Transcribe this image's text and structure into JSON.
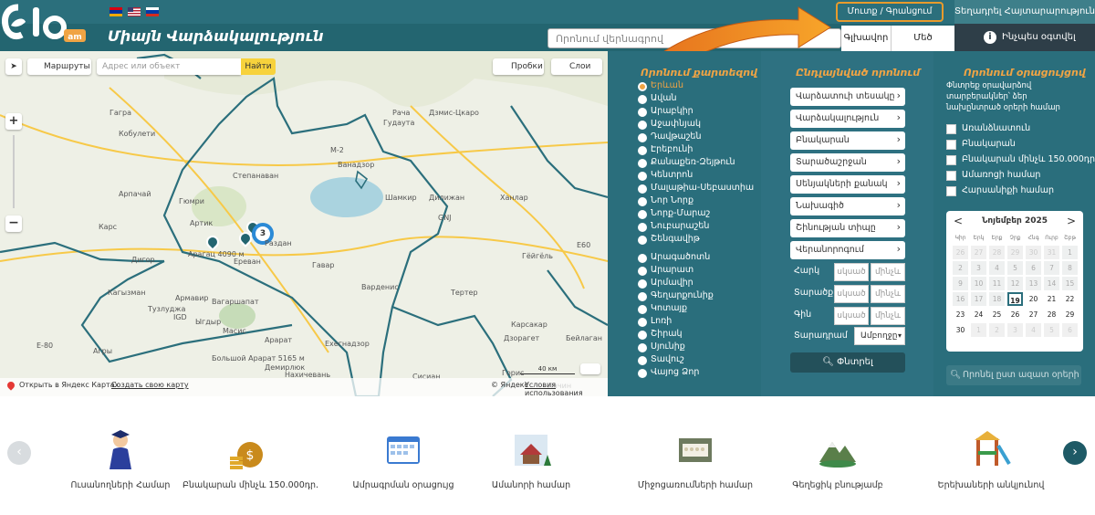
{
  "header": {
    "tagline": "Միայն Վարձակալություն",
    "search_placeholder": "Որոնում վերնագրով",
    "login_label": "Մուտք / Գրանցում",
    "add_listing_label": "Տեղադրել Հայտարարություն",
    "nav_home": "Գլխավոր",
    "nav_map": "Մեծ Քարտեզ",
    "nav_how": "Ինչպես օգտվել"
  },
  "map": {
    "routes_label": "Маршруты",
    "search_placeholder": "Адрес или объект",
    "find_label": "Найти",
    "traffic_label": "Пробки",
    "layers_label": "Слои",
    "scale_label": "40 км",
    "open_yandex_label": "Открыть в Яндекс Картах",
    "create_map_label": "Создать свою карту",
    "copyright_label": "© Яндекс",
    "terms_label": "Условия использования",
    "cluster_count": "3",
    "places": [
      "Рача",
      "Гудаута",
      "Дзмис-Цкаро",
      "М-2",
      "Ванадзор",
      "Гагра",
      "Кобулети",
      "Степанаван",
      "Дилижан",
      "Арпачай",
      "Гюмри",
      "Шамкир",
      "Артик",
      "Ханлар",
      "GNJ",
      "Карс",
      "Арагац 4090 м",
      "Раздан",
      "E60",
      "Дигор",
      "Ереван",
      "Гавар",
      "Гёйгёль",
      "Кагызман",
      "Армавир",
      "Вагаршапат",
      "Варденис",
      "Тузлуджа",
      "IGD",
      "Ыгдыр",
      "E-80",
      "Арарат",
      "Ехегнадзор",
      "Агры",
      "Масис",
      "Дзорагет",
      "Большой Арарат 5165 м",
      "Демирлюк",
      "Нахичевань",
      "Сисиан",
      "Горис",
      "Лачин",
      "Патнос",
      "Шахбуз",
      "Джульфа",
      "Мегри",
      "Бейлаган",
      "Карсакар",
      "Тертер"
    ]
  },
  "districts": {
    "title": "Որոնում քարտեզով",
    "group1": [
      "Երևան",
      "Ավան",
      "Արաբկիր",
      "Աջափնյակ",
      "Դավթաշեն",
      "Էրեբունի",
      "Քանաքեռ-Զեյթուն",
      "Կենտրոն",
      "Մալաթիա-Սեբաստիա",
      "Նոր Նորք",
      "Նորք-Մարաշ",
      "Նուբարաշեն",
      "Շենգավիթ"
    ],
    "group2": [
      "Արագածոտն",
      "Արարատ",
      "Արմավիր",
      "Գեղարքունիք",
      "Կոտայք",
      "Լոռի",
      "Շիրակ",
      "Սյունիք",
      "Տավուշ",
      "Վայոց Ձոր"
    ],
    "selected": "Երևան"
  },
  "advanced": {
    "title": "Ընդլայնված որոնում",
    "selects": [
      "Վարձատուի տեսակը",
      "Վարձակալություն",
      "Բնակարան",
      "Տարածաշրջան",
      "Սենյակների քանակ",
      "Նախագիծ",
      "Շինության տիպը",
      "Վերանորոգում"
    ],
    "area_label": "Հարկ",
    "space_label": "Տարածք",
    "price_label": "Գին",
    "from_placeholder": "սկսած",
    "to_placeholder": "մինչև",
    "period_label": "Տարադրամ",
    "period_value": "Ամբողջը",
    "search_button": "Փնտրել"
  },
  "calendar_panel": {
    "title": "Որոնում օրացույցով",
    "description": "Փնտրեք օրավարձով տարբերակներ՝ ձեր նախընտրած օրերի համար",
    "checkboxes": [
      "Առանձնատուն",
      "Բնակարան",
      "Բնակարան մինչև 150.000դր.",
      "Ամառոցի համար",
      "Հարսանիքի համար"
    ],
    "month_label": "Նոյեմբեր 2025",
    "prev": "<",
    "next": ">",
    "weekdays": [
      "Կիր",
      "Երկ",
      "Երք",
      "Չրք",
      "Հնգ",
      "Ուրբ",
      "Շբթ"
    ],
    "days": [
      "26",
      "27",
      "28",
      "29",
      "30",
      "31",
      "1",
      "2",
      "3",
      "4",
      "5",
      "6",
      "7",
      "8",
      "9",
      "10",
      "11",
      "12",
      "13",
      "14",
      "15",
      "16",
      "17",
      "18",
      "19",
      "20",
      "21",
      "22",
      "23",
      "24",
      "25",
      "26",
      "27",
      "28",
      "29",
      "30",
      "1",
      "2",
      "3",
      "4",
      "5",
      "6"
    ],
    "today": "19",
    "free_days_placeholder": "Որոնել ըստ ազատ օրերի"
  },
  "categories": [
    "Ուսանողների Համար",
    "Բնակարան մինչև 150.000դր.",
    "Ամրագրման օրացույց",
    "Ամանորի համար",
    "Միջոցառումների համար",
    "Գեղեցիկ բնությամբ",
    "Երեխաների անկյունով"
  ],
  "colors": {
    "teal": "#2a6e7c",
    "orange": "#f0a444",
    "dark": "#2e3e48",
    "yellow": "#f7c948"
  }
}
